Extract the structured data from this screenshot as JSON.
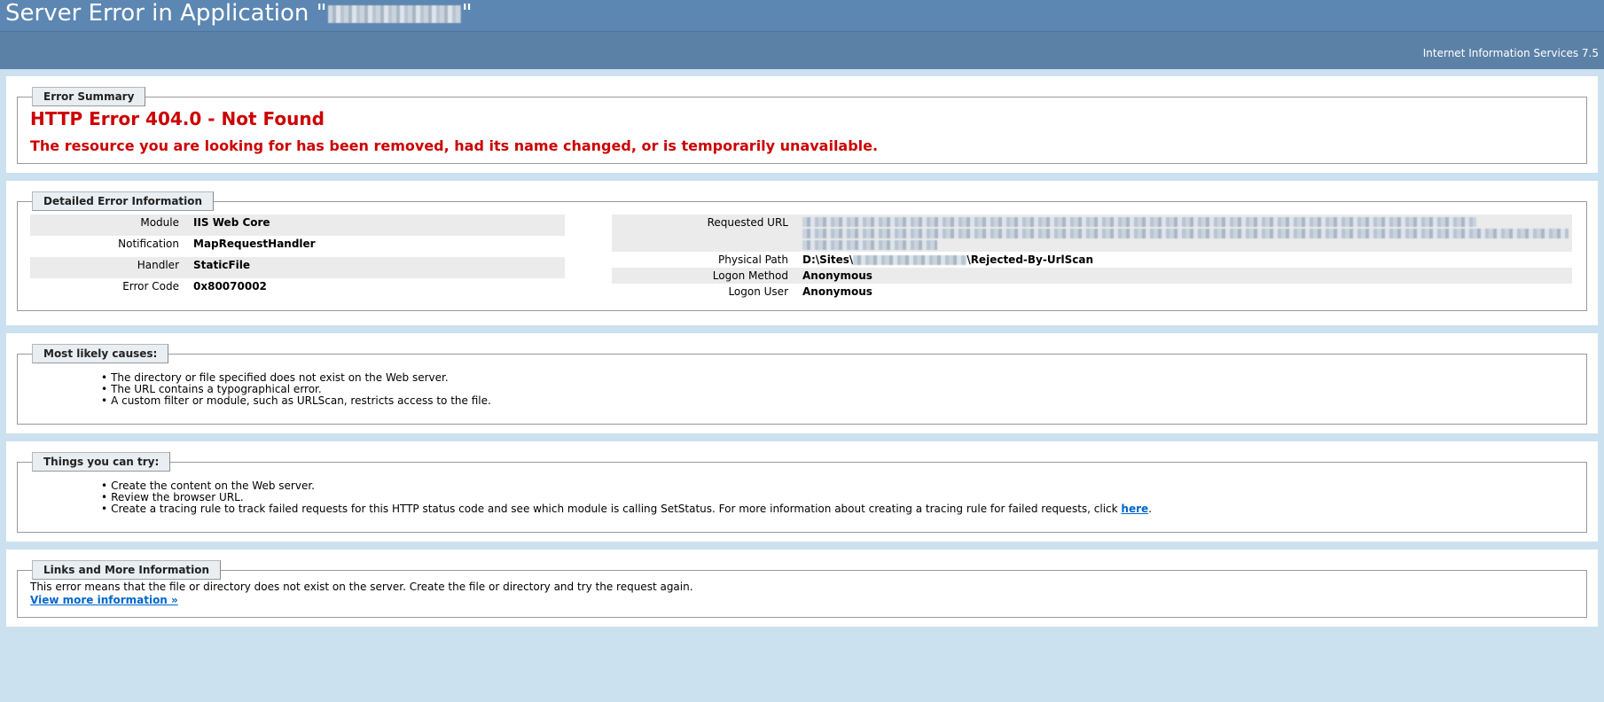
{
  "header": {
    "title_prefix": "Server Error in Application \"",
    "title_suffix": "\""
  },
  "subheader": {
    "server": "Internet Information Services 7.5"
  },
  "summary": {
    "legend": "Error Summary",
    "title": "HTTP Error 404.0 - Not Found",
    "message": "The resource you are looking for has been removed, had its name changed, or is temporarily unavailable."
  },
  "details": {
    "legend": "Detailed Error Information",
    "left": [
      {
        "key": "Module",
        "value": "IIS Web Core"
      },
      {
        "key": "Notification",
        "value": "MapRequestHandler"
      },
      {
        "key": "Handler",
        "value": "StaticFile"
      },
      {
        "key": "Error Code",
        "value": "0x80070002"
      }
    ],
    "right": {
      "requested_url_key": "Requested URL",
      "physical_path_key": "Physical Path",
      "physical_path_prefix": "D:\\Sites\\",
      "physical_path_suffix": "\\Rejected-By-UrlScan",
      "logon_method_key": "Logon Method",
      "logon_method_value": "Anonymous",
      "logon_user_key": "Logon User",
      "logon_user_value": "Anonymous"
    }
  },
  "causes": {
    "legend": "Most likely causes:",
    "items": [
      "The directory or file specified does not exist on the Web server.",
      "The URL contains a typographical error.",
      "A custom filter or module, such as URLScan, restricts access to the file."
    ]
  },
  "try": {
    "legend": "Things you can try:",
    "items": [
      "Create the content on the Web server.",
      "Review the browser URL."
    ],
    "item3_text": "Create a tracing rule to track failed requests for this HTTP status code and see which module is calling SetStatus. For more information about creating a tracing rule for failed requests, click ",
    "item3_link": "here",
    "item3_end": "."
  },
  "links": {
    "legend": "Links and More Information",
    "text": "This error means that the file or directory does not exist on the server. Create the file or directory and try the request again.",
    "more_link": "View more information »"
  }
}
